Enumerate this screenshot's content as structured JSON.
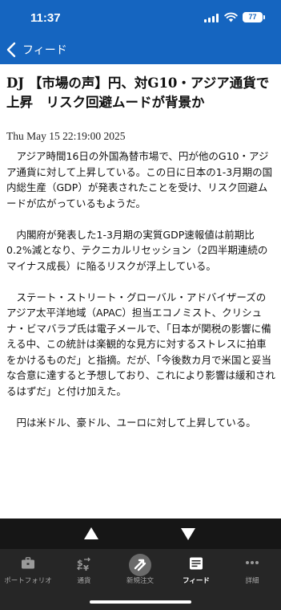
{
  "status_bar": {
    "time": "11:37",
    "battery": "77"
  },
  "nav": {
    "back_label": "フィード"
  },
  "article": {
    "headline": "DJ 【市場の声】円、対G10・アジア通貨で上昇　リスク回避ムードが背景か",
    "dateline": "Thu May 15 22:19:00 2025",
    "paragraphs": [
      "アジア時間16日の外国為替市場で、円が他のG10・アジア通貨に対して上昇している。この日に日本の1-3月期の国内総生産（GDP）が発表されたことを受け、リスク回避ムードが広がっているもようだ。",
      "内閣府が発表した1-3月期の実質GDP速報値は前期比0.2%減となり、テクニカルリセッション（2四半期連続のマイナス成長）に陥るリスクが浮上している。",
      "ステート・ストリート・グローバル・アドバイザーズのアジア太平洋地域（APAC）担当エコノミスト、クリシュナ・ビマバラプ氏は電子メールで、「日本が関税の影響に備える中、この統計は楽観的な見方に対するストレスに拍車をかけるものだ」と指摘。だが、「今後数カ月で米国と妥当な合意に達すると予想しており、これにより影響は緩和されるはずだ」と付け加えた。",
      "円は米ドル、豪ドル、ユーロに対して上昇している。"
    ]
  },
  "tabbar": {
    "portfolio": "ポートフォリオ",
    "currency": "通貨",
    "new_order": "新規注文",
    "feed": "フィード",
    "details": "詳細"
  },
  "colors": {
    "nav_blue": "#1565c0",
    "tab_bg": "#262626",
    "arrow_bg": "#161616"
  }
}
